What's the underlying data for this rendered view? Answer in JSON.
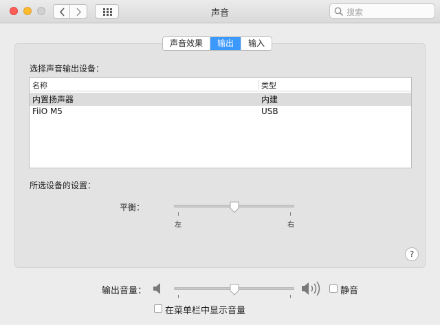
{
  "window": {
    "title": "声音"
  },
  "search": {
    "placeholder": "搜索"
  },
  "tabs": [
    {
      "label": "声音效果",
      "active": false
    },
    {
      "label": "输出",
      "active": true
    },
    {
      "label": "输入",
      "active": false
    }
  ],
  "output": {
    "device_section_label": "选择声音输出设备：",
    "table": {
      "headers": [
        "名称",
        "类型"
      ],
      "rows": [
        {
          "name": "内置扬声器",
          "type": "内建",
          "selected": true
        },
        {
          "name": "FiiO M5",
          "type": "USB",
          "selected": false
        }
      ]
    },
    "settings_label": "所选设备的设置：",
    "balance": {
      "label": "平衡：",
      "left_label": "左",
      "right_label": "右",
      "value": 0.5
    }
  },
  "volume": {
    "label": "输出音量：",
    "value": 0.5,
    "mute_label": "静音",
    "mute_checked": false,
    "show_in_menubar_label": "在菜单栏中显示音量",
    "show_in_menubar_checked": false
  },
  "help": {
    "label": "?"
  }
}
